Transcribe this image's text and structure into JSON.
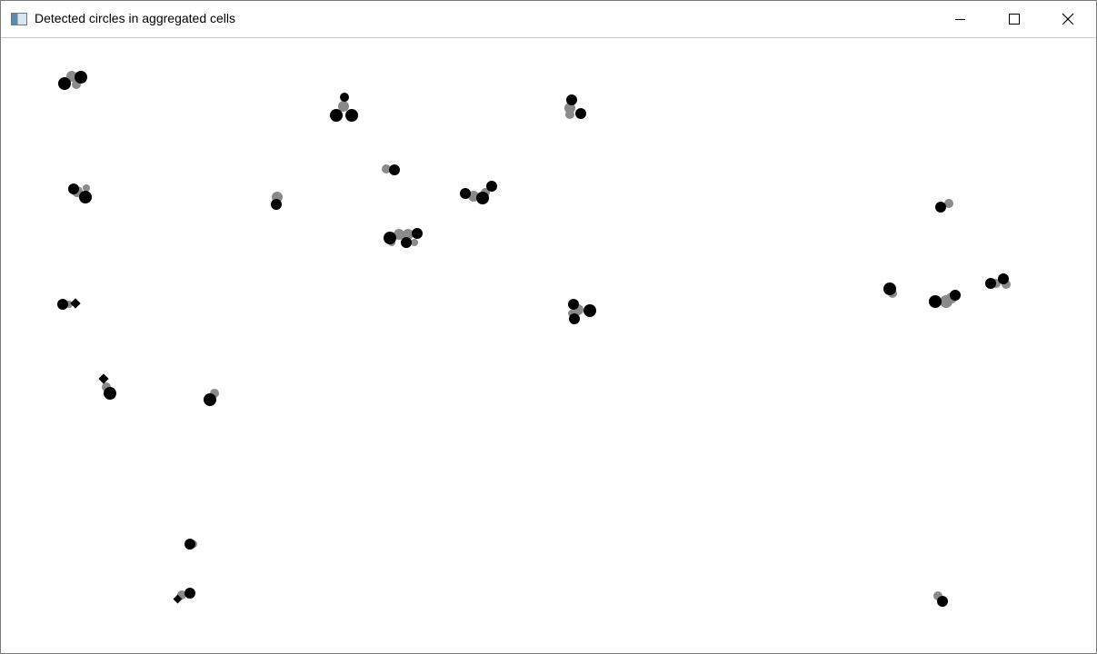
{
  "window": {
    "title": "Detected circles in aggregated cells"
  },
  "icons": {
    "app": "app-window-icon",
    "minimize": "minimize-icon",
    "maximize": "maximize-icon",
    "close": "close-icon"
  },
  "colors": {
    "detected_circle": "#000000",
    "cell_blob": "#8a8a8a",
    "background": "#ffffff"
  }
}
